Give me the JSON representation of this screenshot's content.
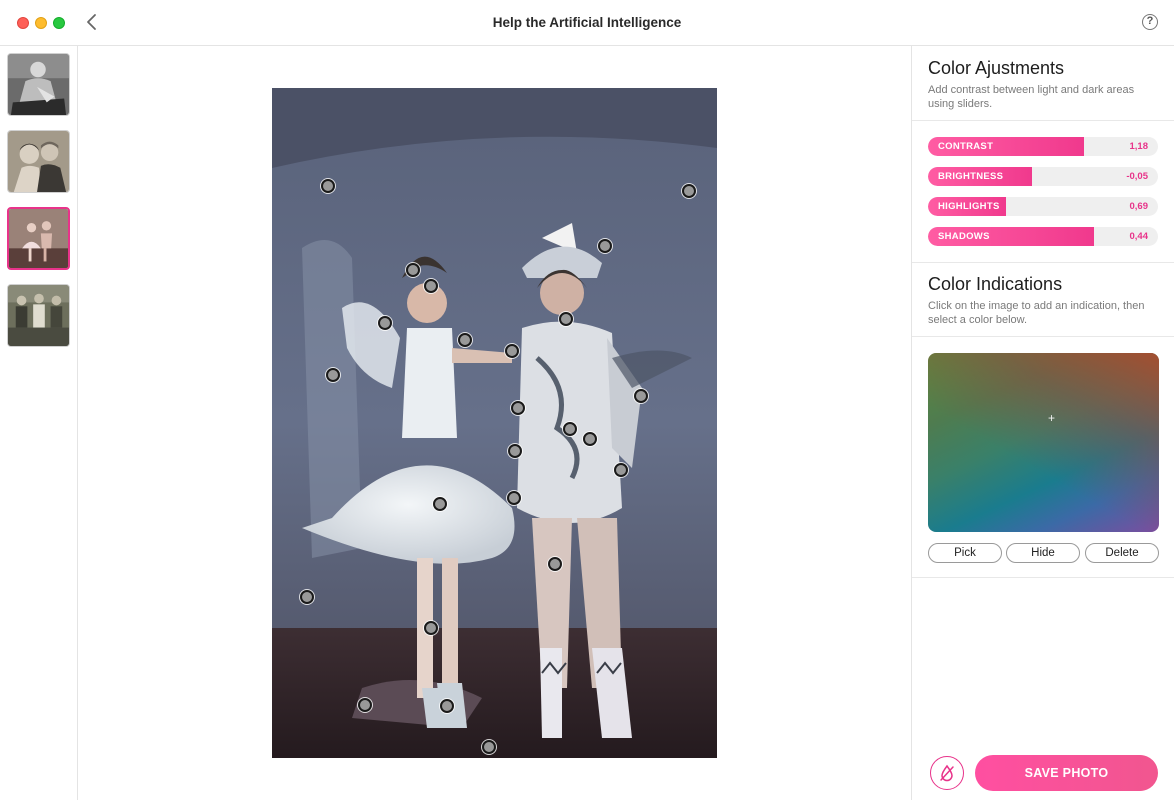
{
  "window": {
    "title": "Help the Artificial Intelligence",
    "back_icon": "chevron-left-icon",
    "help_label": "?"
  },
  "thumbnails": [
    {
      "name": "vintage-portrait-seated-woman",
      "selected": false
    },
    {
      "name": "vintage-portrait-couple",
      "selected": false
    },
    {
      "name": "vintage-portrait-dancers",
      "selected": true
    },
    {
      "name": "vintage-portrait-group",
      "selected": false
    }
  ],
  "color_adjustments": {
    "title": "Color Ajustments",
    "description": "Add contrast between light and dark areas using sliders.",
    "sliders": [
      {
        "label": "CONTRAST",
        "value": "1,18",
        "fill_fraction": 0.68
      },
      {
        "label": "BRIGHTNESS",
        "value": "-0,05",
        "fill_fraction": 0.45
      },
      {
        "label": "HIGHLIGHTS",
        "value": "0,69",
        "fill_fraction": 0.34
      },
      {
        "label": "SHADOWS",
        "value": "0,44",
        "fill_fraction": 0.72
      }
    ]
  },
  "color_indications": {
    "title": "Color Indications",
    "description": "Click on the image to add an indication, then select a color below.",
    "buttons": {
      "pick": "Pick",
      "hide": "Hide",
      "delete": "Delete"
    }
  },
  "actions": {
    "save_label": "SAVE PHOTO",
    "eraser_icon": "eraser-icon"
  },
  "colors": {
    "accent": "#e8338a",
    "accent_light": "#ff5ca3"
  }
}
